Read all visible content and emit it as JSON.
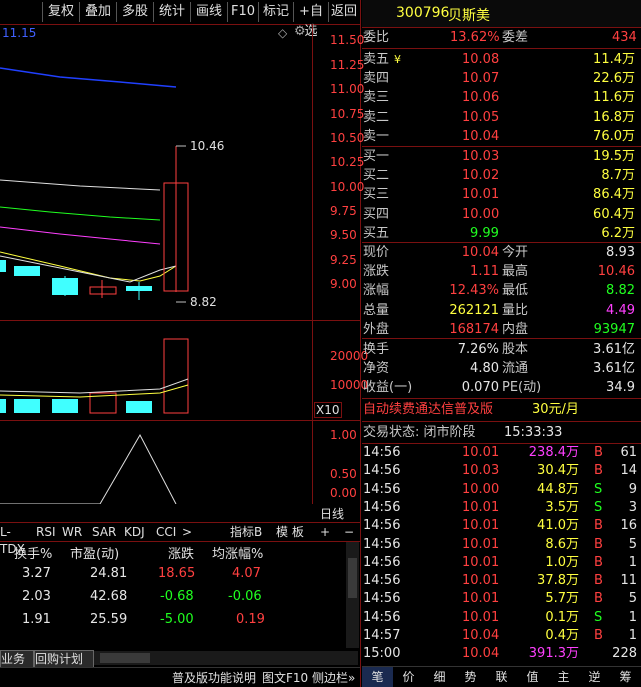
{
  "toolbar": {
    "buttons": [
      "复权",
      "叠加",
      "多股",
      "统计",
      "画线",
      "F10",
      "标记",
      "+自选",
      "返回"
    ]
  },
  "chart": {
    "top_left_value": "11.15",
    "price_axis": [
      "11.50",
      "11.25",
      "11.00",
      "10.75",
      "10.50",
      "10.25",
      "10.00",
      "9.75",
      "9.50",
      "9.25",
      "9.00"
    ],
    "high_annotation": "10.46",
    "low_annotation": "8.82",
    "volume_axis": [
      "20000",
      "10000"
    ],
    "volume_unit": "X10",
    "indicator_axis": [
      "1.00",
      "0.50",
      "0.00"
    ],
    "day_line_label": "日线",
    "indicator_tabs": [
      "L-TDX",
      "RSI",
      "WR",
      "SAR",
      "KDJ",
      "CCI",
      ">"
    ],
    "indicator_b": "指标B",
    "template": "模 板",
    "plus": "+",
    "minus": "−"
  },
  "table": {
    "headers": [
      "换手%",
      "市盈(动)",
      "涨跌",
      "均涨幅%"
    ],
    "rows": [
      {
        "turnover": "3.27",
        "pe": "24.81",
        "change": "18.65",
        "avg": "4.07",
        "color": "red"
      },
      {
        "turnover": "2.03",
        "pe": "42.68",
        "change": "-0.68",
        "avg": "-0.06",
        "color": "green"
      },
      {
        "turnover": "1.91",
        "pe": "25.59",
        "change": "-5.00",
        "avg": "0.19",
        "color": "green"
      }
    ],
    "bottom_tabs": [
      "业务",
      "回购计划"
    ]
  },
  "footer_left": {
    "buttons": [
      "普及版功能说明",
      "图文F10",
      "侧边栏»"
    ]
  },
  "quote": {
    "code": "300796",
    "name": "贝斯美",
    "weibi_label": "委比",
    "weibi": "13.62%",
    "weicha_label": "委差",
    "weicha": "434",
    "asks": [
      {
        "label": "卖五",
        "mark": "¥",
        "price": "10.08",
        "vol": "11.4万"
      },
      {
        "label": "卖四",
        "mark": "",
        "price": "10.07",
        "vol": "22.6万"
      },
      {
        "label": "卖三",
        "mark": "",
        "price": "10.06",
        "vol": "11.6万"
      },
      {
        "label": "卖二",
        "mark": "",
        "price": "10.05",
        "vol": "16.8万"
      },
      {
        "label": "卖一",
        "mark": "",
        "price": "10.04",
        "vol": "76.0万"
      }
    ],
    "bids": [
      {
        "label": "买一",
        "price": "10.03",
        "vol": "19.5万"
      },
      {
        "label": "买二",
        "price": "10.02",
        "vol": "8.7万"
      },
      {
        "label": "买三",
        "price": "10.01",
        "vol": "86.4万"
      },
      {
        "label": "买四",
        "price": "10.00",
        "vol": "60.4万"
      },
      {
        "label": "买五",
        "price": "9.99",
        "vol": "6.2万"
      }
    ],
    "stats": [
      {
        "l1": "现价",
        "v1": "10.04",
        "c1": "red",
        "l2": "今开",
        "v2": "8.93",
        "c2": "white"
      },
      {
        "l1": "涨跌",
        "v1": "1.11",
        "c1": "red",
        "l2": "最高",
        "v2": "10.46",
        "c2": "red"
      },
      {
        "l1": "涨幅",
        "v1": "12.43%",
        "c1": "red",
        "l2": "最低",
        "v2": "8.82",
        "c2": "green"
      },
      {
        "l1": "总量",
        "v1": "262121",
        "c1": "yellow",
        "l2": "量比",
        "v2": "4.49",
        "c2": "purple"
      },
      {
        "l1": "外盘",
        "v1": "168174",
        "c1": "red",
        "l2": "内盘",
        "v2": "93947",
        "c2": "green"
      }
    ],
    "fin": [
      {
        "l1": "换手",
        "v1": "7.26%",
        "l2": "股本",
        "v2": "3.61亿"
      },
      {
        "l1": "净资",
        "v1": "4.80",
        "l2": "流通",
        "v2": "3.61亿"
      },
      {
        "l1": "收益(一)",
        "v1": "0.070",
        "l2": "PE(动)",
        "v2": "34.9"
      }
    ],
    "promo": "自动续费通达信普及版",
    "promo_price": "30元/月",
    "status_label": "交易状态: 闭市阶段",
    "status_time": "15:33:33",
    "ticks": [
      {
        "t": "14:56",
        "p": "10.01",
        "v": "238.4万",
        "vc": "purple",
        "s": "B",
        "n": "61"
      },
      {
        "t": "14:56",
        "p": "10.03",
        "v": "30.4万",
        "vc": "yellow",
        "s": "B",
        "n": "14"
      },
      {
        "t": "14:56",
        "p": "10.00",
        "v": "44.8万",
        "vc": "yellow",
        "s": "S",
        "n": "9"
      },
      {
        "t": "14:56",
        "p": "10.01",
        "v": "3.5万",
        "vc": "yellow",
        "s": "S",
        "n": "3"
      },
      {
        "t": "14:56",
        "p": "10.01",
        "v": "41.0万",
        "vc": "yellow",
        "s": "B",
        "n": "16"
      },
      {
        "t": "14:56",
        "p": "10.01",
        "v": "8.6万",
        "vc": "yellow",
        "s": "B",
        "n": "5"
      },
      {
        "t": "14:56",
        "p": "10.01",
        "v": "1.0万",
        "vc": "yellow",
        "s": "B",
        "n": "1"
      },
      {
        "t": "14:56",
        "p": "10.01",
        "v": "37.8万",
        "vc": "yellow",
        "s": "B",
        "n": "11"
      },
      {
        "t": "14:56",
        "p": "10.01",
        "v": "5.7万",
        "vc": "yellow",
        "s": "B",
        "n": "5"
      },
      {
        "t": "14:56",
        "p": "10.01",
        "v": "0.1万",
        "vc": "yellow",
        "s": "S",
        "n": "1"
      },
      {
        "t": "14:57",
        "p": "10.04",
        "v": "0.4万",
        "vc": "yellow",
        "s": "B",
        "n": "1"
      },
      {
        "t": "15:00",
        "p": "10.04",
        "v": "391.3万",
        "vc": "purple",
        "s": "",
        "n": "228"
      }
    ],
    "bottom_tabs": [
      "笔",
      "价",
      "细",
      "势",
      "联",
      "值",
      "主",
      "逆",
      "筹"
    ]
  }
}
